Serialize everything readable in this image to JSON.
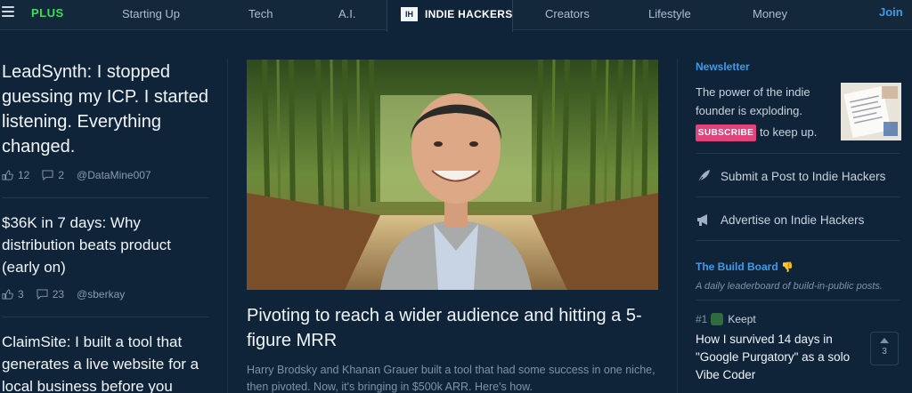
{
  "nav": {
    "plus": "PLUS",
    "links": [
      "Starting Up",
      "Tech",
      "A.I.",
      "Creators",
      "Lifestyle",
      "Money"
    ],
    "brand_logo": "IH",
    "brand_name": "INDIE HACKERS",
    "join": "Join"
  },
  "left_posts": [
    {
      "title": "LeadSynth: I stopped guessing my ICP. I started listening. Everything changed.",
      "likes": "12",
      "comments": "2",
      "author": "@DataMine007"
    },
    {
      "title": "$36K in 7 days: Why distribution beats product (early on)",
      "likes": "3",
      "comments": "23",
      "author": "@sberkay"
    },
    {
      "title": "ClaimSite: I built a tool that generates a live website for a local business before you"
    }
  ],
  "feature": {
    "title": "Pivoting to reach a wider audience and hitting a 5-figure MRR",
    "subtitle": "Harry Brodsky and Khanan Grauer built a tool that had some success in one niche, then pivoted. Now, it's bringing in $500k ARR. Here's how."
  },
  "sidebar": {
    "newsletter_heading": "Newsletter",
    "newsletter_text": "The power of the indie founder is exploding.",
    "subscribe_label": "SUBSCRIBE",
    "subscribe_suffix": "to keep up.",
    "submit_link": "Submit a Post to Indie Hackers",
    "advertise_link": "Advertise on Indie Hackers",
    "buildboard_heading": "The Build Board",
    "buildboard_emoji": "👎",
    "buildboard_sub": "A daily leaderboard of build-in-public posts.",
    "top_rank": "#1",
    "top_name": "Keept",
    "top_title": "How I survived 14 days in \"Google Purgatory\" as a solo Vibe Coder",
    "top_votes": "3"
  },
  "colors": {
    "background": "#0f2438",
    "accent": "#3d9be9",
    "plus": "#3ddc5a",
    "subscribe": "#e0447d"
  },
  "icons": [
    "menu-icon",
    "thumbs-up-icon",
    "comment-icon",
    "quill-icon",
    "megaphone-icon",
    "upvote-arrow-icon"
  ]
}
